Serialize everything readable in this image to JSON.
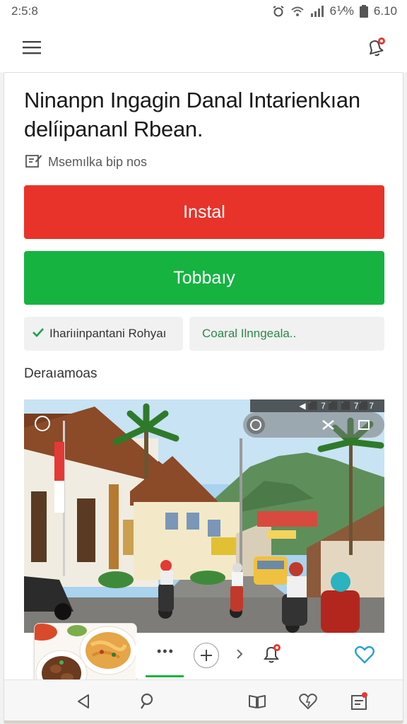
{
  "status_bar": {
    "time": "2:5:8",
    "battery": "6⅟%",
    "clock_right": "6.10",
    "icons": [
      "alarm-icon",
      "wifi-icon",
      "signal-icon",
      "battery-icon"
    ]
  },
  "app_bar": {
    "menu_icon": "hamburger-menu-icon",
    "notification_icon": "bell-icon"
  },
  "article": {
    "title": "Ninanpn Ingagin Danal Intarienkıan delíipananl Rbean.",
    "meta": "Msemılka bip nos"
  },
  "buttons": {
    "primary": "Instal",
    "secondary": "Tobbaıy"
  },
  "chips": {
    "first": "Ihariıinpantani Rohyaı",
    "second": "Coaral Ilnngeala.."
  },
  "section": {
    "label": "Deraıamoas"
  },
  "photo_overlay": {
    "counter": "◀ ⬛ 7 ⬛ ⬛ 7⬛7"
  },
  "colors": {
    "red": "#e8332a",
    "green": "#16b341",
    "badge": "#e53935",
    "heart": "#2a9fd6"
  }
}
